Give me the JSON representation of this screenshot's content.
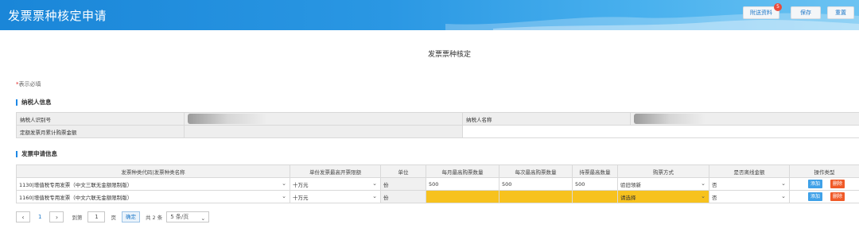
{
  "header": {
    "title": "发票票种核定申请",
    "attachments_label": "附送资料",
    "attachments_badge": "5",
    "save_label": "保存",
    "reset_label": "重置"
  },
  "page_heading": "发票票种核定",
  "required_note": {
    "star": "*",
    "text": "表示必填"
  },
  "taxpayer": {
    "section_title": "纳税人信息",
    "id_label": "纳税人识别号",
    "id_value": "",
    "name_label": "纳税人名称",
    "name_value": "",
    "amount_label": "定额发票月累计购票金额",
    "amount_value": ""
  },
  "invoice": {
    "section_title": "发票申请信息",
    "columns": [
      "发票种类代码|发票种类名称",
      "单份发票最高开票限额",
      "单位",
      "每月最高购票数量",
      "每次最高购票数量",
      "持票最高数量",
      "购票方式",
      "是否离线金额",
      "操作类型"
    ],
    "rows": [
      {
        "type": "1130|增值税专用发票（中文三联无金额限制版）",
        "limit": "十万元",
        "unit": "份",
        "monthly": "500",
        "per_time": "500",
        "hold": "500",
        "method": "验旧领新",
        "offline": "否",
        "add": "添加",
        "del": "删除"
      },
      {
        "type": "1160|增值税专用发票（中文六联无金额限制版）",
        "limit": "十万元",
        "unit": "份",
        "monthly": "",
        "per_time": "",
        "hold": "",
        "method": "请选择",
        "offline": "否",
        "add": "添加",
        "del": "删除"
      }
    ]
  },
  "pager": {
    "prev": "‹",
    "current_page": "1",
    "next": "›",
    "goto_label": "到第",
    "goto_value": "1",
    "page_label": "页",
    "confirm_label": "确定",
    "total": "共 2 条",
    "page_size": "5 条/页"
  },
  "colors": {
    "header_start": "#1a86d8",
    "header_end": "#6cc3f2",
    "required_highlight": "#f7c21e",
    "add_button": "#3fa1e8",
    "delete_button": "#f05a28"
  }
}
